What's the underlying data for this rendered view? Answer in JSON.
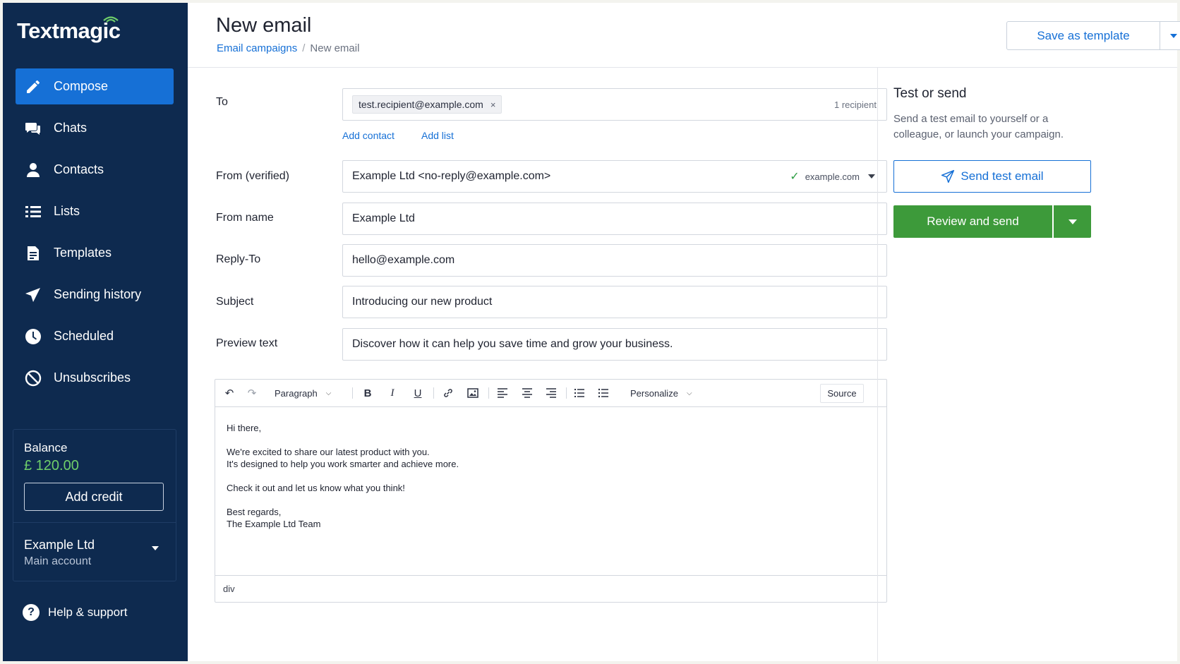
{
  "app": {
    "logo": "Textmagic"
  },
  "sidebar": {
    "items": [
      {
        "label": "Compose",
        "icon": "pencil-icon",
        "active": true
      },
      {
        "label": "Chats",
        "icon": "chat-bubbles-icon"
      },
      {
        "label": "Contacts",
        "icon": "person-icon"
      },
      {
        "label": "Lists",
        "icon": "list-icon"
      },
      {
        "label": "Templates",
        "icon": "document-icon"
      },
      {
        "label": "Sending history",
        "icon": "paper-plane-icon"
      },
      {
        "label": "Scheduled",
        "icon": "clock-icon"
      },
      {
        "label": "Unsubscribes",
        "icon": "block-icon"
      }
    ],
    "balance": {
      "label": "Balance",
      "value": "£ 120.00",
      "add_credit": "Add credit"
    },
    "account": {
      "name": "Example Ltd",
      "sub": "Main account"
    },
    "help": {
      "label": "Help & support"
    }
  },
  "header": {
    "title": "New email",
    "breadcrumb": {
      "link": "Email campaigns",
      "separator": "/",
      "current": "New email"
    },
    "save_template": "Save as template"
  },
  "form": {
    "to": {
      "label": "To",
      "chip": "test.recipient@example.com",
      "chip_remove": "×",
      "count": "1 recipient",
      "add_contact": "Add contact",
      "add_list": "Add list"
    },
    "from": {
      "label": "From (verified)",
      "value": "Example Ltd <no-reply@example.com>",
      "check": "✓",
      "domain": "example.com"
    },
    "from_name": {
      "label": "From name",
      "value": "Example Ltd"
    },
    "reply_to": {
      "label": "Reply-To",
      "value": "hello@example.com"
    },
    "subject": {
      "label": "Subject",
      "value": "Introducing our new product"
    },
    "preview": {
      "label": "Preview text",
      "value": "Discover how it can help you save time and grow your business."
    }
  },
  "editor": {
    "toolbar": {
      "undo": "↶",
      "redo": "↷",
      "paragraph": "Paragraph",
      "bold": "B",
      "italic": "I",
      "underline": "U",
      "personalize": "Personalize",
      "source": "Source"
    },
    "body": [
      "Hi there,",
      "We're excited to share our latest product with you.",
      "It's designed to help you work smarter and achieve more.",
      "Check it out and let us know what you think!",
      "Best regards,",
      "The Example Ltd Team"
    ],
    "status": "div"
  },
  "right_panel": {
    "title": "Test or send",
    "desc": "Send a test email to yourself or a colleague, or launch your campaign.",
    "send_test": "Send test email",
    "review_send": "Review and send"
  },
  "colors": {
    "sidebar": "#0e2a4f",
    "accent": "#1670d6",
    "success": "#3d9a3a",
    "balance": "#6fcf6a"
  }
}
